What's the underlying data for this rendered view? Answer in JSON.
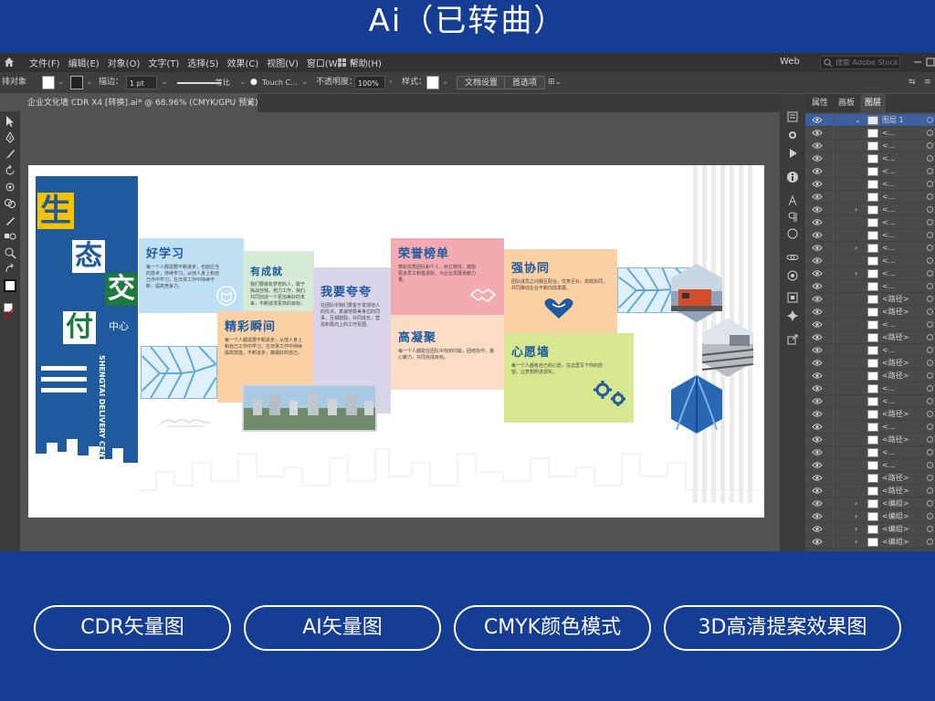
{
  "banner": {
    "title": "Ai（已转曲）"
  },
  "colors": {
    "background": "#143d93",
    "brand_blue": "#1f5a9e",
    "yellow": "#f6c200",
    "green": "#1e7a3c"
  },
  "menubar": {
    "items": [
      "文件(F)",
      "编辑(E)",
      "对象(O)",
      "文字(T)",
      "选择(S)",
      "效果(C)",
      "视图(V)",
      "窗口(W)",
      "帮助(H)"
    ],
    "workspace": "Web",
    "search_placeholder": "搜索 Adobe Stock"
  },
  "control_bar": {
    "no_selection": "排对象",
    "stroke_label": "描边：",
    "stroke_value": "1 pt",
    "stroke_profile": "等比",
    "brush": "Touch C...",
    "opacity_label": "不透明度：",
    "opacity_value": "100%",
    "style_label": "样式：",
    "doc_setup": "文档设置",
    "prefs": "首选项"
  },
  "document_tab": {
    "label": "企业文化墙 CDR X4 [转换].ai* @ 68.96% (CMYK/GPU 预览)",
    "close": "×"
  },
  "layers_panel": {
    "tabs": [
      "属性",
      "画板",
      "图层"
    ],
    "top_layer": "图层 1",
    "rows": [
      "<...",
      "<...",
      "<...",
      "<...",
      "<...",
      "<...",
      "<...",
      "<...",
      "<...",
      "<...",
      "<...",
      "<...",
      "<...",
      "<路径>",
      "<路径>",
      "<...",
      "<路径>",
      "<...",
      "<路径>",
      "<路径>",
      "<...",
      "<...",
      "<路径>",
      "<...",
      "<路径>",
      "<...",
      "<...",
      "<路径>",
      "<路径>",
      "<编组>",
      "<编组>",
      "<编组>",
      "<编组>"
    ]
  },
  "artboard": {
    "chars": [
      "生",
      "态",
      "交",
      "付"
    ],
    "center_cn": "中心",
    "center_en": "SHENGTAI DELIVERY CENTER",
    "cards": [
      {
        "title": "好学习",
        "body": "每一个人都需要不断进步，也能应当的技术，持续学习，从他人身上和自己作中学习，在日常工作中持续不断，提高竞争力。"
      },
      {
        "title": "有成就",
        "body": "我们要做有梦想的人，敢于挑战自我，努力工作，我们共同创造一个更加美好的未来，不断追求更高的目标。"
      },
      {
        "title": "精彩瞬间",
        "body": "每一个人都需要不断进步，从他人身上和自己工作中学习，在日常工作中持续提高技能，不断进步，做最好的自己。"
      },
      {
        "title": "我要夸夸",
        "body": "在团队中我们要善于发现他人的优点，真诚地赞美身边的同事，互相鼓励，共同成长，营造积极向上的工作氛围。"
      },
      {
        "title": "荣誉榜单",
        "body": "表彰优秀团队和个人，树立榜样，激励更多员工积极进取，为企业发展贡献力量。"
      },
      {
        "title": "高凝聚",
        "body": "每一个人都能在团队中找到归属，团结协作，凝心聚力，共同完成目标。"
      },
      {
        "title": "强协同",
        "body": "团队成员之间相互配合，优势互补，高效协同，共同推动企业不断向前发展。"
      },
      {
        "title": "心愿墙",
        "body": "每一个人都有自己的心愿，在这里写下你的愿望，让梦想照进现实。"
      }
    ]
  }
}
